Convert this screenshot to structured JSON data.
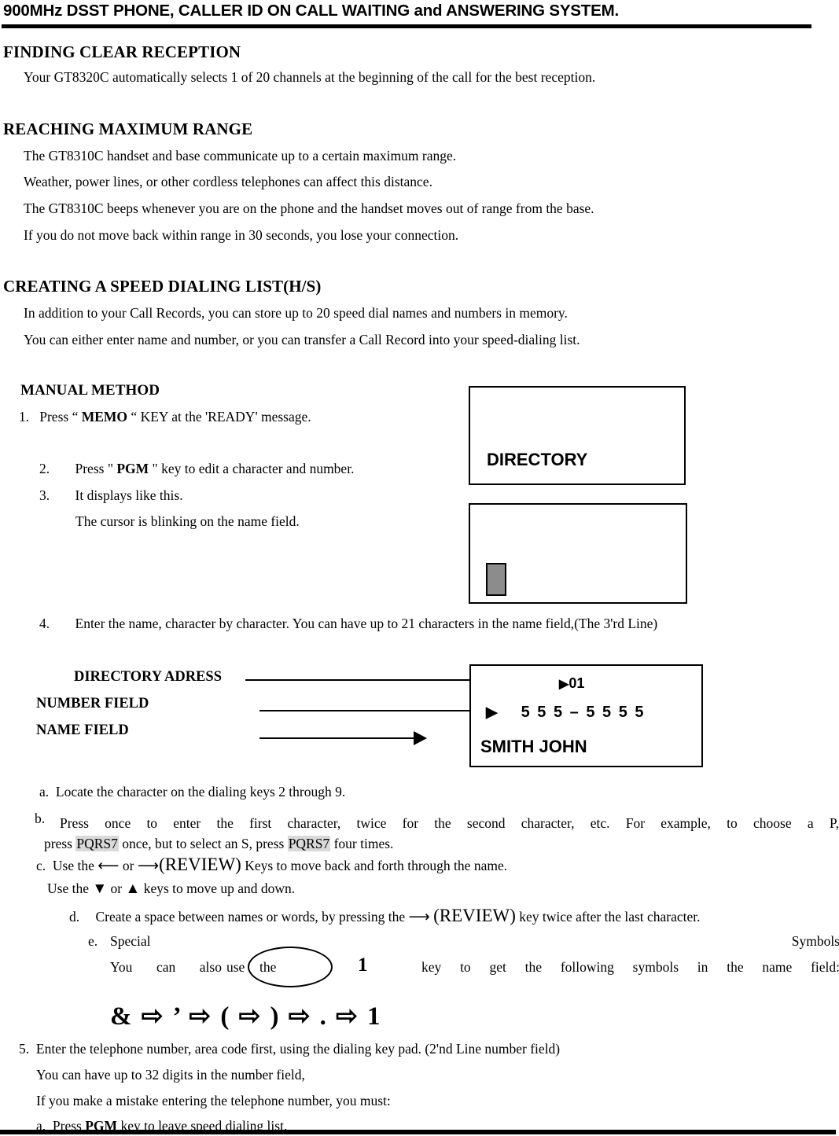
{
  "header": {
    "title": "900MHz DSST PHONE, CALLER ID ON CALL WAITING and ANSWERING SYSTEM."
  },
  "sections": [
    {
      "heading": "FINDING CLEAR RECEPTION",
      "lines": [
        "Your GT8320C automatically selects 1 of 20 channels at the beginning of the call for the best reception."
      ]
    },
    {
      "heading": "REACHING MAXIMUM RANGE",
      "lines": [
        "The GT8310C handset and base communicate up to a certain maximum range.",
        "Weather, power lines, or other cordless telephones can affect this distance.",
        "The GT8310C beeps whenever you are on the phone and the handset moves out of range from the base.",
        "If you do not move back within range in 30 seconds, you lose your connection."
      ]
    },
    {
      "heading": "CREATING A SPEED DIALING LIST(H/S)",
      "lines": [
        "In addition to your Call Records, you can store up to 20 speed dial names and numbers in memory.",
        "You can either enter name and number, or you can transfer a Call Record into your speed-dialing list."
      ]
    }
  ],
  "manual": {
    "heading": "MANUAL METHOD",
    "step1": {
      "num": "1.",
      "pre": "Press “ ",
      "key": "MEMO",
      "post": " “ KEY at the 'READY' message."
    },
    "step2": {
      "num": "2.",
      "pre": "Press \" ",
      "key": "PGM",
      "post": " \" key to edit a character and number."
    },
    "step3": {
      "num": "3.",
      "text": "It displays like this.",
      "sub": "The cursor is blinking on the name field."
    },
    "step4": {
      "num": "4.",
      "text": "Enter the name, character by character.  You can have up to 21 characters in the name field,(The 3'rd Line)"
    }
  },
  "lcd": {
    "screen1_text": "DIRECTORY",
    "screen3": {
      "index": "01",
      "number": "5 5 5 – 5 5 5 5",
      "name": "SMITH JOHN",
      "index_marker": "▶",
      "number_marker": "▶"
    }
  },
  "callouts": [
    {
      "label": "DIRECTORY ADRESS"
    },
    {
      "label": "NUMBER FIELD"
    },
    {
      "label": "NAME FIELD"
    }
  ],
  "substeps": {
    "a": {
      "marker": "a.",
      "text": "Locate the character on the dialing keys 2 through 9."
    },
    "b": {
      "marker": "b.",
      "part1": "Press once to enter the first character, twice for the second character, etc. For example, to choose a P,",
      "part2_pre": "press ",
      "key1": "PQRS7",
      "part2_mid": " once, but to select an S, press ",
      "key2": "PQRS7",
      "part2_post": " four times."
    },
    "c": {
      "marker": "c.",
      "pre": "Use the ",
      "arrow_left": "⟵",
      "mid": " or ",
      "arrow_right": "⟶",
      "review": "(REVIEW)",
      "post": " Keys to move back and forth through the name.",
      "line2_pre": "Use the ",
      "arrow_down": "▼",
      "line2_mid": " or ",
      "arrow_up": "▲",
      "line2_post": " keys to move up and down."
    },
    "d": {
      "marker": "d.",
      "pre": "Create a space between names or words, by pressing the ",
      "arrow_right": "⟶",
      "review": "(REVIEW)",
      "post": " key twice after the last character."
    },
    "e": {
      "marker": "e.",
      "left_word": "Special",
      "right_word": "Symbols",
      "line2_words": [
        "You",
        "can",
        "also",
        "use",
        "the"
      ],
      "big_one": "1",
      "line2_rest": [
        "key",
        "to",
        "get",
        "the",
        "following",
        "symbols",
        "in",
        "the",
        "name",
        "field:"
      ],
      "symbols_row": "&  ⇨  ’  ⇨  (  ⇨  )  ⇨  .  ⇨  1"
    }
  },
  "step5": {
    "num": "5.",
    "line1": "Enter the telephone number, area code first, using the dialing key pad. (2'nd Line number field)",
    "line2": "You can have up to 32 digits in the number field,",
    "line3": "If you make a mistake entering the telephone number, you must:",
    "line4_marker": "a.",
    "line4_pre": "Press ",
    "line4_key": "PGM",
    "line4_post": " key to leave speed dialing list."
  }
}
